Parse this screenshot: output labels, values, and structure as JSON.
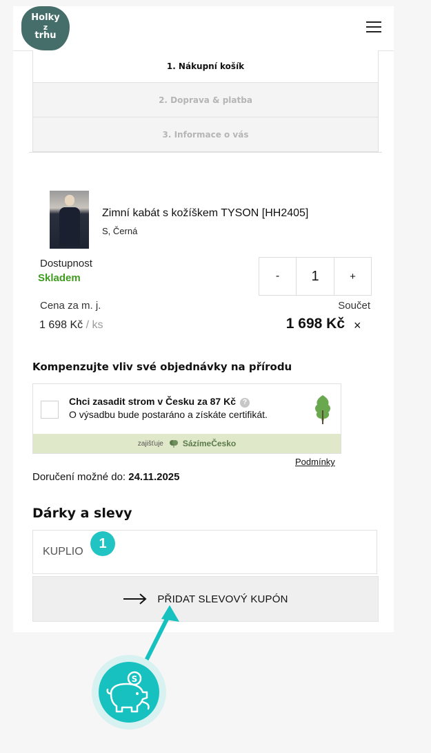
{
  "header": {
    "logo_line1": "Holky",
    "logo_line2": "z",
    "logo_line3": "trhu"
  },
  "steps": [
    {
      "label": "1. Nákupní košík"
    },
    {
      "label": "2. Doprava & platba"
    },
    {
      "label": "3. Informace o vás"
    }
  ],
  "product": {
    "name": "Zimní kabát s kožíškem TYSON [HH2405]",
    "variant": "S, Černá",
    "availability_label": "Dostupnost",
    "availability_value": "Skladem",
    "availability_color": "#3e9b1f",
    "quantity": "1",
    "minus_label": "-",
    "plus_label": "+",
    "unit_price_label": "Cena za m. j.",
    "unit_price": "1 698 Kč",
    "unit_suffix": "/ ks",
    "total_label": "Součet",
    "total": "1 698 Kč",
    "remove_label": "×"
  },
  "compensation": {
    "title": "Kompenzujte vliv své objednávky na přírodu",
    "main": "Chci zasadit strom v Česku za 87 Kč",
    "help_icon": "?",
    "sub": "O výsadbu bude postaráno a získáte certifikát.",
    "footer_prefix": "zajišťuje",
    "footer_brand": "SázímeČesko",
    "conditions": "Podmínky"
  },
  "delivery": {
    "label": "Doručení možné do:",
    "date": "24.11.2025"
  },
  "gifts": {
    "title": "Dárky a slevy",
    "coupon_value": "KUPLIO",
    "badge": "1",
    "add_button": "PŘIDAT SLEVOVÝ KUPÓN"
  },
  "colors": {
    "accent": "#16c1c0",
    "logo_bg": "#456e6b"
  }
}
